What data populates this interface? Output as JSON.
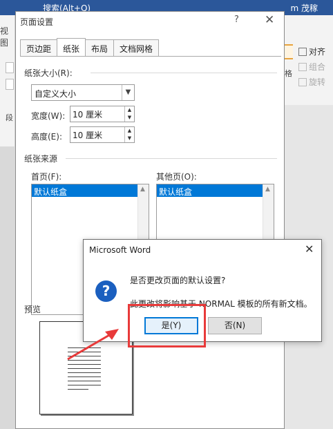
{
  "word": {
    "search_label": "搜索(Alt+Q)",
    "user_label": "m 茂稼",
    "ribbon": {
      "view": "视图",
      "paragraph": "段",
      "format_label": "格",
      "align": "对齐",
      "group": "组合",
      "rotate": "旋转"
    }
  },
  "page_setup": {
    "title": "页面设置",
    "help": "?",
    "close": "✕",
    "tabs": [
      "页边距",
      "纸张",
      "布局",
      "文档网格"
    ],
    "active_tab": "纸张",
    "paper_size_label": "纸张大小(R):",
    "paper_size_value": "自定义大小",
    "width_label": "宽度(W):",
    "width_value": "10 厘米",
    "height_label": "高度(E):",
    "height_value": "10 厘米",
    "paper_source_label": "纸张来源",
    "first_page_label": "首页(F):",
    "first_page_selected": "默认纸盒",
    "other_pages_label": "其他页(O):",
    "other_pages_selected": "默认纸盒",
    "preview_label": "预览"
  },
  "message_box": {
    "title": "Microsoft Word",
    "close": "✕",
    "icon": "question-icon",
    "icon_glyph": "?",
    "line1": "是否更改页面的默认设置?",
    "line2": "此更改将影响基于 NORMAL 模板的所有新文档。",
    "yes_label": "是(Y)",
    "no_label": "否(N)"
  },
  "colors": {
    "accent": "#0078d7",
    "highlight": "#e83a3a",
    "word_brand": "#2b579a"
  }
}
